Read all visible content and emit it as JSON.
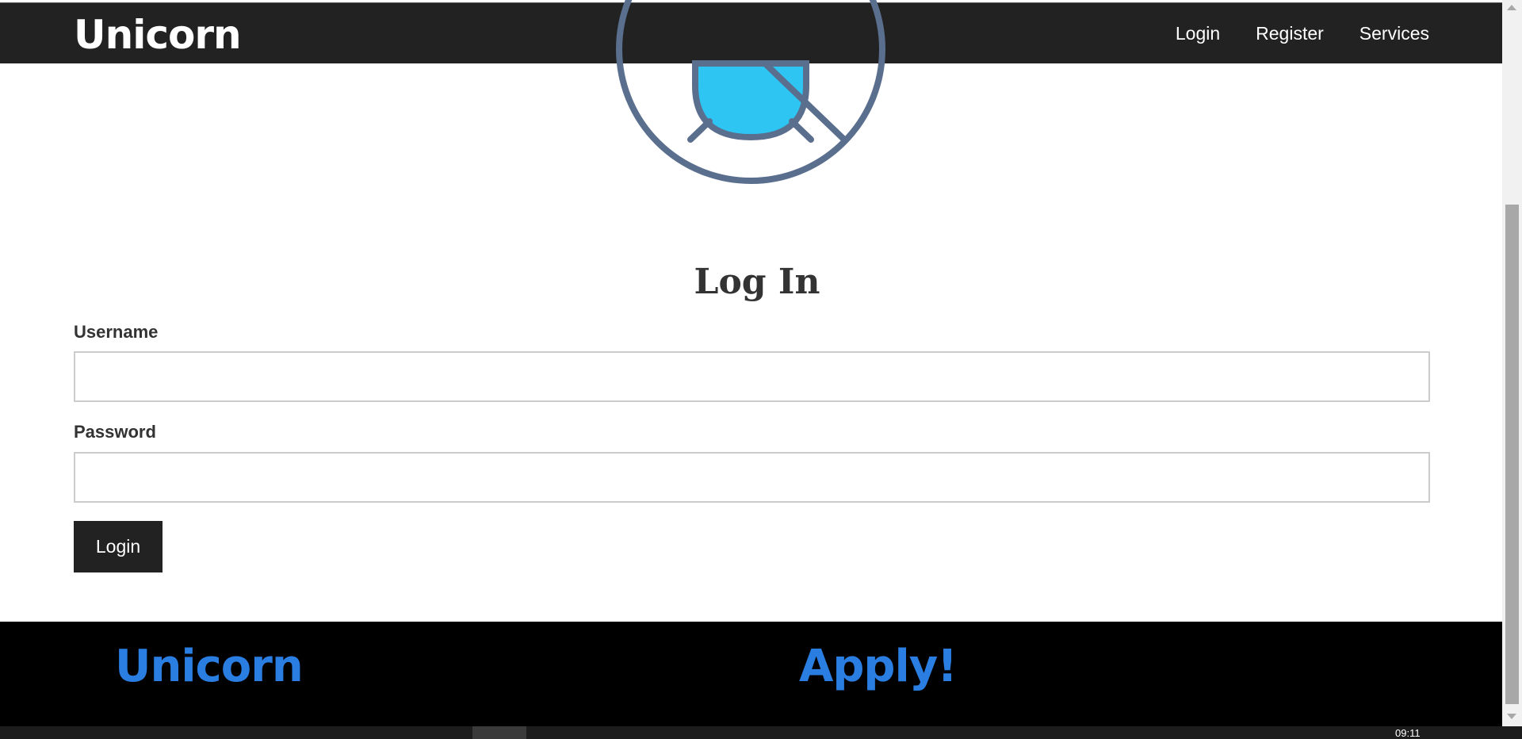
{
  "navbar": {
    "brand": "Unicorn",
    "links": [
      "Login",
      "Register",
      "Services"
    ]
  },
  "hero": {
    "icon": "no-bug-icon"
  },
  "form": {
    "title": "Log In",
    "username_label": "Username",
    "username_value": "",
    "password_label": "Password",
    "password_value": "",
    "submit_label": "Login"
  },
  "footer": {
    "brand": "Unicorn",
    "apply": "Apply!"
  },
  "taskbar": {
    "clock": "09:11"
  },
  "colors": {
    "navbar_bg": "#222222",
    "footer_bg": "#000000",
    "footer_accent": "#2a7de1",
    "icon_stroke": "#5a6e8e",
    "icon_fill": "#2ec5f3"
  }
}
